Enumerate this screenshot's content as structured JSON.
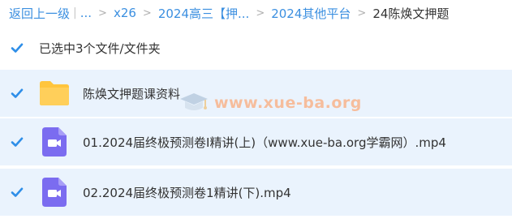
{
  "breadcrumb": {
    "back": "返回上一级",
    "separator_bar": "|",
    "ellipsis": "...",
    "arrow": ">",
    "items": [
      "x26",
      "2024高三【押...",
      "2024其他平台"
    ],
    "current": "24陈焕文押题"
  },
  "selection": {
    "label": "已选中3个文件/文件夹",
    "checked": true
  },
  "files": [
    {
      "name": "陈焕文押题课资料",
      "type": "folder",
      "icon": "folder-icon",
      "checked": true
    },
    {
      "name": "01.2024届终极预测卷I精讲(上)（www.xue-ba.org学霸网）.mp4",
      "type": "video",
      "icon": "video-icon",
      "checked": true
    },
    {
      "name": "02.2024届终极预测卷1精讲(下).mp4",
      "type": "video",
      "icon": "video-icon",
      "checked": true
    }
  ],
  "watermark": {
    "text": "www.xue-ba.org"
  },
  "colors": {
    "link": "#3b8fe0",
    "row_selected_bg": "#eaf3fd",
    "checkbox": "#2e8ee8",
    "folder": "#ffc53d",
    "video": "#7b6cf0",
    "watermark": "#ff9a5c"
  }
}
